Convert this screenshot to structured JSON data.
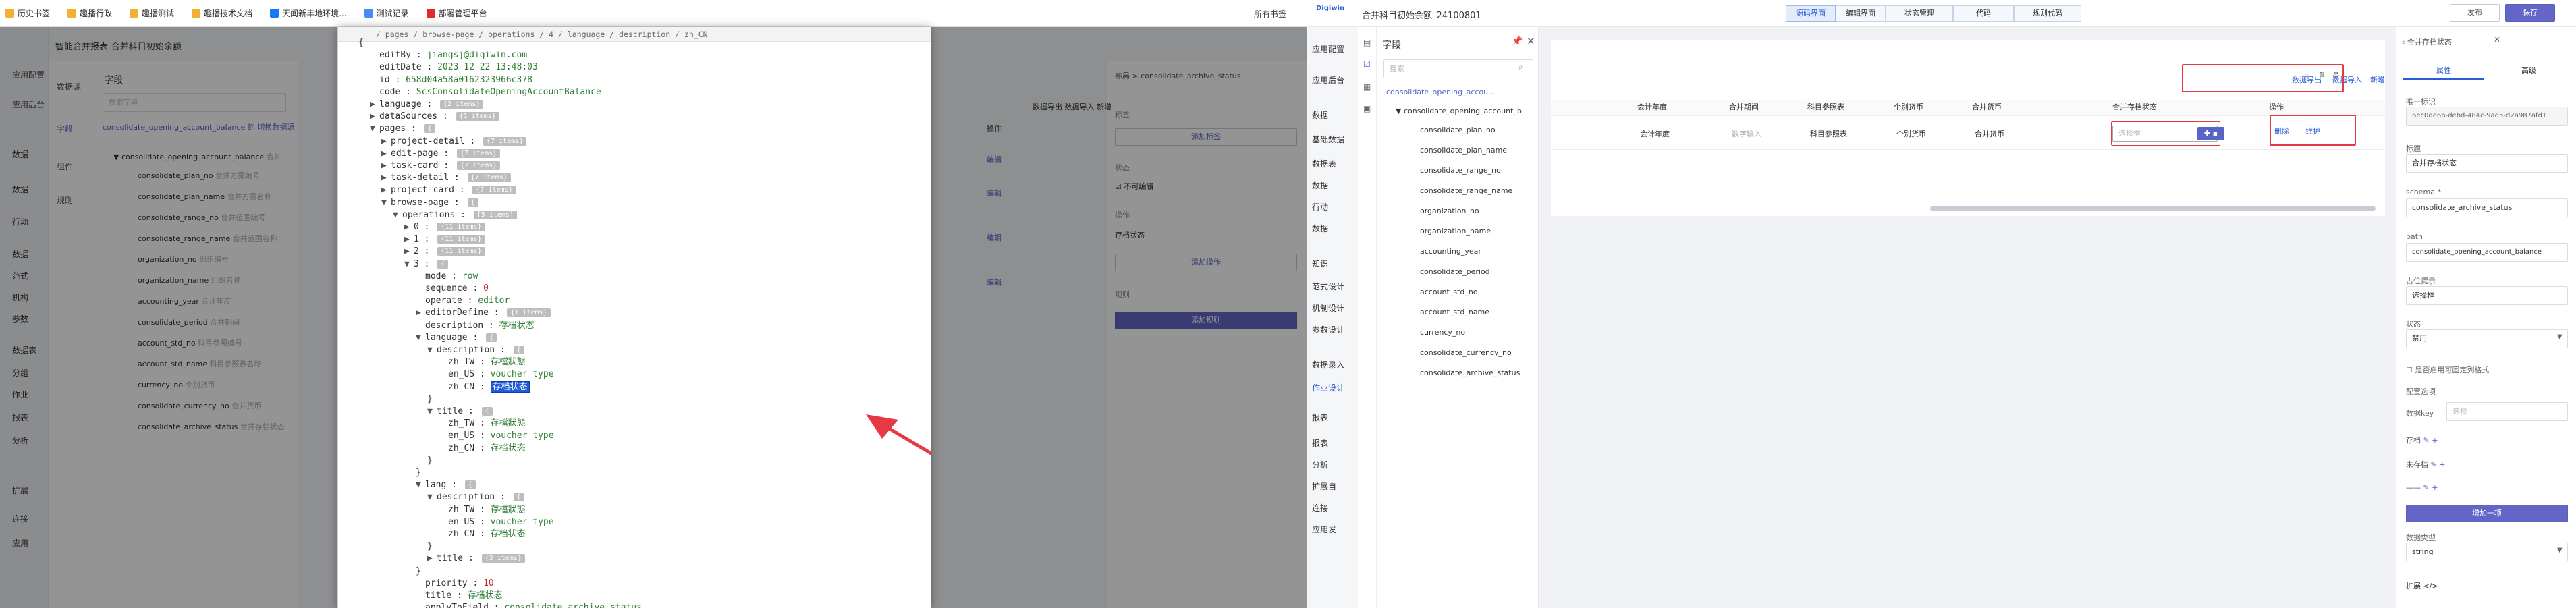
{
  "bookmarks": {
    "items": [
      {
        "label": "历史书签",
        "color": "#f2b134"
      },
      {
        "label": "趣播行政",
        "color": "#f2b134"
      },
      {
        "label": "趣播测试",
        "color": "#f2b134"
      },
      {
        "label": "趣播技术文档",
        "color": "#f2b134"
      },
      {
        "label": "天闻新丰地环境...",
        "color": "#1877f2"
      },
      {
        "label": "测试记录",
        "color": "#4a8af4"
      },
      {
        "label": "部署管理平台",
        "color": "#e02b2b"
      }
    ],
    "all": "所有书签"
  },
  "left_app": {
    "title": "智能合并报表-合并科目初始余额",
    "nav": [
      "应用配置",
      "应用后台",
      "数据",
      "数据",
      "行动",
      "数据",
      "范式",
      "机构",
      "参数",
      "数据表",
      "分组",
      "作业",
      "报表",
      "分析",
      "扩展",
      "连接",
      "应用"
    ],
    "icons": [
      "数据源",
      "字段",
      "组件",
      "规则"
    ],
    "panel_title": "字段",
    "search_placeholder": "搜索字段",
    "entity": "consolidate_opening_account_balance 的 切换数据源",
    "root": "consolidate_opening_account_balance",
    "root_cn": "合并",
    "fields": [
      {
        "name": "consolidate_plan_no",
        "cn": "合并方案编号"
      },
      {
        "name": "consolidate_plan_name",
        "cn": "合并方案名称"
      },
      {
        "name": "consolidate_range_no",
        "cn": "合并范围编号"
      },
      {
        "name": "consolidate_range_name",
        "cn": "合并范围名称"
      },
      {
        "name": "organization_no",
        "cn": "组织编号"
      },
      {
        "name": "organization_name",
        "cn": "组织名称"
      },
      {
        "name": "accounting_year",
        "cn": "会计年度"
      },
      {
        "name": "consolidate_period",
        "cn": "合并期间"
      },
      {
        "name": "account_std_no",
        "cn": "科目参照编号"
      },
      {
        "name": "account_std_name",
        "cn": "科目参照表名称"
      },
      {
        "name": "currency_no",
        "cn": "个别货币"
      },
      {
        "name": "consolidate_currency_no",
        "cn": "合并货币"
      },
      {
        "name": "consolidate_archive_status",
        "cn": "合并存档状态"
      }
    ],
    "right": {
      "breadcrumb": "布局 > consolidate_archive_status",
      "toolbar": "数据导出 数据导入 新增",
      "col_op": "操作",
      "edit": "编辑",
      "sec1": "标签",
      "add_tag": "添加标签",
      "sec2": "状态",
      "not_edit": "不可编辑",
      "sec3": "操作",
      "op_item": "存档状态",
      "add_op": "添加操作",
      "sec4": "规则",
      "add_rule": "添加规则"
    }
  },
  "code": {
    "path": "/ pages / browse-page / operations / 4 / language / description / zh_CN",
    "lines": [
      {
        "i": 0,
        "t": "tw",
        "text": "{"
      },
      {
        "i": 1,
        "k": "editBy",
        "v": "jiangsj@digiwin.com",
        "vt": "s"
      },
      {
        "i": 1,
        "k": "editDate",
        "v": "2023-12-22 13:48:03",
        "vt": "s"
      },
      {
        "i": 1,
        "k": "id",
        "v": "658d04a58a0162323966c378",
        "vt": "s"
      },
      {
        "i": 1,
        "k": "code",
        "v": "ScsConsolidateOpeningAccountBalance",
        "vt": "s"
      },
      {
        "i": 1,
        "k": "language",
        "tw": "▶",
        "b": "{2 items}"
      },
      {
        "i": 1,
        "k": "dataSources",
        "tw": "▶",
        "b": "{1 items}"
      },
      {
        "i": 1,
        "k": "pages",
        "tw": "▼",
        "b": "{"
      },
      {
        "i": 2,
        "k": "project-detail",
        "tw": "▶",
        "b": "{7 items}"
      },
      {
        "i": 2,
        "k": "edit-page",
        "tw": "▶",
        "b": "{7 items}"
      },
      {
        "i": 2,
        "k": "task-card",
        "tw": "▶",
        "b": "{7 items}"
      },
      {
        "i": 2,
        "k": "task-detail",
        "tw": "▶",
        "b": "{7 items}"
      },
      {
        "i": 2,
        "k": "project-card",
        "tw": "▶",
        "b": "{7 items}"
      },
      {
        "i": 2,
        "k": "browse-page",
        "tw": "▼",
        "b": "{"
      },
      {
        "i": 3,
        "k": "operations",
        "tw": "▼",
        "b": "[5 items]"
      },
      {
        "i": 4,
        "k": "0",
        "tw": "▶",
        "b": "{11 items}"
      },
      {
        "i": 4,
        "k": "1",
        "tw": "▶",
        "b": "{11 items}"
      },
      {
        "i": 4,
        "k": "2",
        "tw": "▶",
        "b": "{11 items}"
      },
      {
        "i": 4,
        "k": "3",
        "tw": "▼",
        "b": "{"
      },
      {
        "i": 5,
        "k": "mode",
        "v": "row",
        "vt": "s"
      },
      {
        "i": 5,
        "k": "sequence",
        "v": "0",
        "vt": "n"
      },
      {
        "i": 5,
        "k": "operate",
        "v": "editor",
        "vt": "s"
      },
      {
        "i": 5,
        "k": "editorDefine",
        "tw": "▶",
        "b": "{1 items}"
      },
      {
        "i": 5,
        "k": "description",
        "v": "存档状态",
        "vt": "s"
      },
      {
        "i": 5,
        "k": "language",
        "tw": "▼",
        "b": "{"
      },
      {
        "i": 6,
        "k": "description",
        "tw": "▼",
        "b": "{"
      },
      {
        "i": 7,
        "k": "zh_TW",
        "v": "存檔狀態",
        "vt": "s"
      },
      {
        "i": 7,
        "k": "en_US",
        "v": "voucher type",
        "vt": "s"
      },
      {
        "i": 7,
        "k": "zh_CN",
        "v": "存档状态",
        "vt": "hl"
      },
      {
        "i": 6,
        "t": "tw",
        "text": "}"
      },
      {
        "i": 6,
        "k": "title",
        "tw": "▼",
        "b": "{"
      },
      {
        "i": 7,
        "k": "zh_TW",
        "v": "存檔狀態",
        "vt": "s"
      },
      {
        "i": 7,
        "k": "en_US",
        "v": "voucher type",
        "vt": "s"
      },
      {
        "i": 7,
        "k": "zh_CN",
        "v": "存档状态",
        "vt": "s"
      },
      {
        "i": 6,
        "t": "tw",
        "text": "}"
      },
      {
        "i": 5,
        "t": "tw",
        "text": "}"
      },
      {
        "i": 5,
        "k": "lang",
        "tw": "▼",
        "b": "{"
      },
      {
        "i": 6,
        "k": "description",
        "tw": "▼",
        "b": "{"
      },
      {
        "i": 7,
        "k": "zh_TW",
        "v": "存檔狀態",
        "vt": "s"
      },
      {
        "i": 7,
        "k": "en_US",
        "v": "voucher type",
        "vt": "s"
      },
      {
        "i": 7,
        "k": "zh_CN",
        "v": "存档状态",
        "vt": "s"
      },
      {
        "i": 6,
        "t": "tw",
        "text": "}"
      },
      {
        "i": 6,
        "k": "title",
        "tw": "▶",
        "b": "{3 items}"
      },
      {
        "i": 5,
        "t": "tw",
        "text": "}"
      },
      {
        "i": 5,
        "k": "priority",
        "v": "10",
        "vt": "n"
      },
      {
        "i": 5,
        "k": "title",
        "v": "存档状态",
        "vt": "s"
      },
      {
        "i": 5,
        "k": "applyToField",
        "v": "consolidate_archive_status",
        "vt": "s"
      }
    ]
  },
  "right_app": {
    "logo": "Digiwin",
    "title": "合并科目初始余额_24100801",
    "tabs": [
      "源码界面",
      "编辑界面",
      "状态管理",
      "代码",
      "规则代码"
    ],
    "active_tab": 0,
    "btn_publish": "发布",
    "btn_save": "保存",
    "nav": [
      "应用配置",
      "应用后台",
      "数据",
      "基础数据",
      "数据表",
      "数据",
      "行动",
      "数据",
      "知识",
      "范式设计",
      "机制设计",
      "参数设计",
      "数据录入",
      "作业设计",
      "报表",
      "报表",
      "分析",
      "扩展自",
      "连接",
      "应用发"
    ],
    "field_panel": {
      "title": "字段",
      "search_placeholder": "搜索",
      "entity": "consolidate_opening_accou...",
      "root": "consolidate_opening_account_b"
    },
    "table": {
      "columns": [
        "会计年度",
        "合并期间",
        "科目参照表",
        "个别货币",
        "合并货币",
        "合并存档状态",
        "操作"
      ],
      "cells": [
        "会计年度",
        "数字输入",
        "科目参照表",
        "个别货币",
        "合并货币"
      ],
      "select_placeholder": "选择框",
      "ops": [
        "删除",
        "维护"
      ],
      "toolbar": [
        "数据导出",
        "数据导入",
        "新增"
      ]
    },
    "props": {
      "header": "合并存档状态",
      "tabs": [
        "属性",
        "高级"
      ],
      "uid_label": "唯一标识",
      "uid": "6ec0de6b-debd-484c-9ad5-d2a987afd1",
      "label_label": "标题",
      "label_value": "合并存档状态",
      "schema_label": "schema *",
      "schema_value": "consolidate_archive_status",
      "path_label": "path",
      "path_value": "consolidate_opening_account_balance",
      "placeholder_label": "占位提示",
      "placeholder_value": "选择框",
      "status_label": "状态",
      "status_value": "禁用",
      "check_label": "是否启用可固定列格式",
      "options_label": "配置选项",
      "dict_label": "数据key",
      "dict_placeholder": "选择",
      "tags": [
        "存档",
        "未存档",
        "——"
      ],
      "add_btn": "增加一项",
      "type_label": "数据类型",
      "type_value": "string",
      "expand_label": "扩展 </>"
    }
  }
}
